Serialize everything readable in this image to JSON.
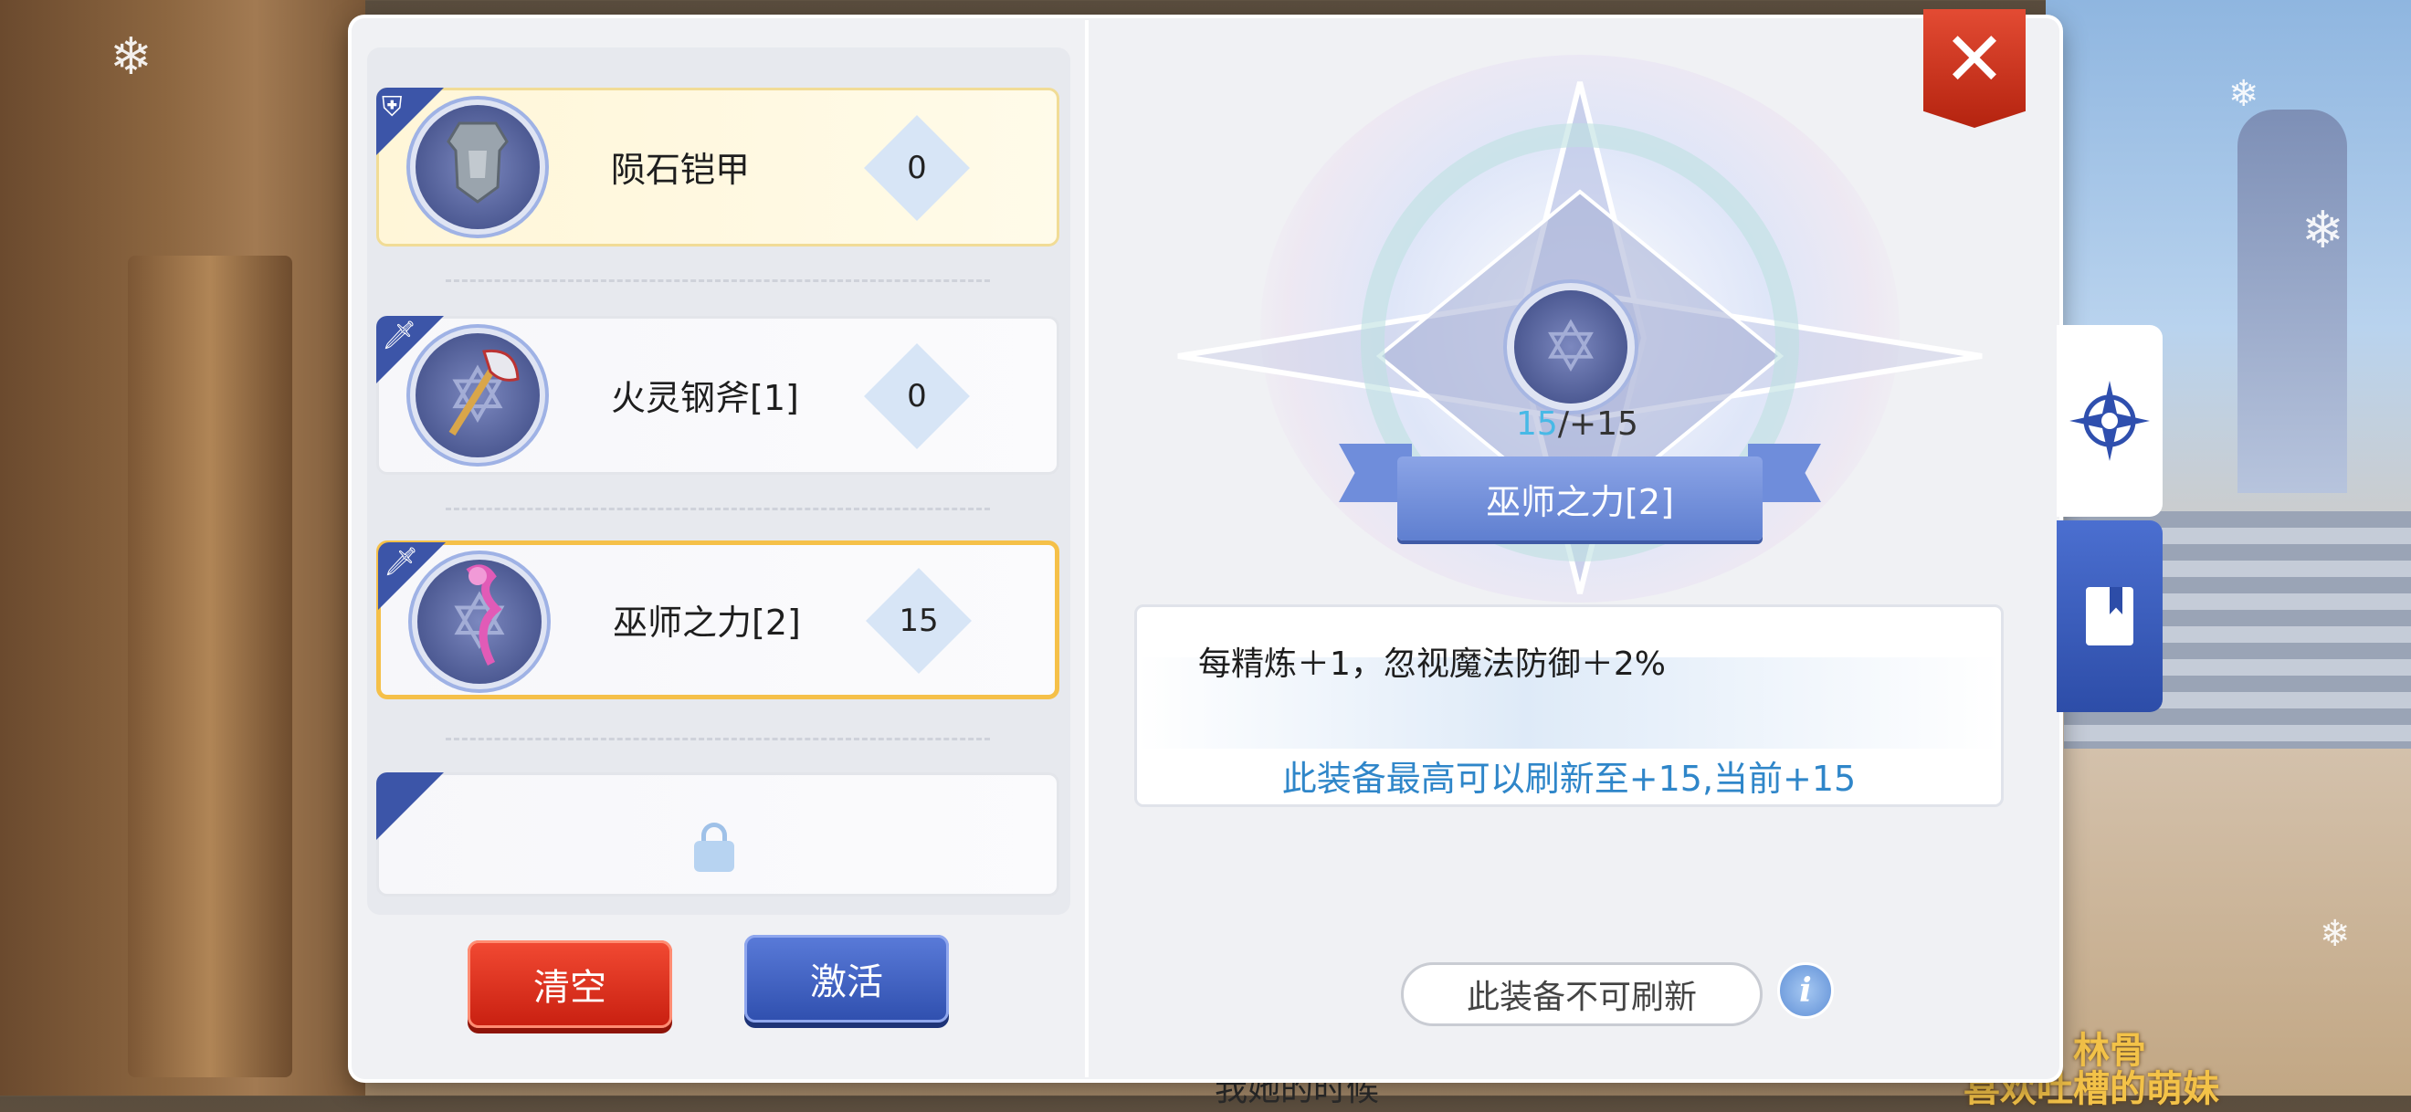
{
  "slots": [
    {
      "name": "陨石铠甲",
      "level": "0",
      "type_icon": "shield-icon",
      "item_icon": "armor-icon"
    },
    {
      "name": "火灵钢斧[1]",
      "level": "0",
      "type_icon": "sword-icon",
      "item_icon": "axe-icon"
    },
    {
      "name": "巫师之力[2]",
      "level": "15",
      "type_icon": "sword-icon",
      "item_icon": "staff-icon",
      "selected": true
    },
    {
      "name": "",
      "level": "",
      "type_icon": "",
      "item_icon": "lock-icon",
      "locked": true
    }
  ],
  "buttons": {
    "clear": "清空",
    "activate": "激活"
  },
  "detail": {
    "current": "15",
    "max": "/+15",
    "item_name": "巫师之力[2]",
    "effect": "每精炼＋1，忽视魔法防御＋2%",
    "refresh_note": "此装备最高可以刷新至+15,当前+15",
    "no_refresh_button": "此装备不可刷新",
    "info_button": "i"
  },
  "close": "✕",
  "background": {
    "text_bottom": "我她的时候",
    "text_right_1": "林骨",
    "text_right_2": "喜欢吐槽的萌妹"
  },
  "colors": {
    "accent_blue": "#3c55a8",
    "accent_red": "#d0301c",
    "selected_border": "#f5c049",
    "level_current": "#48b9e6"
  }
}
